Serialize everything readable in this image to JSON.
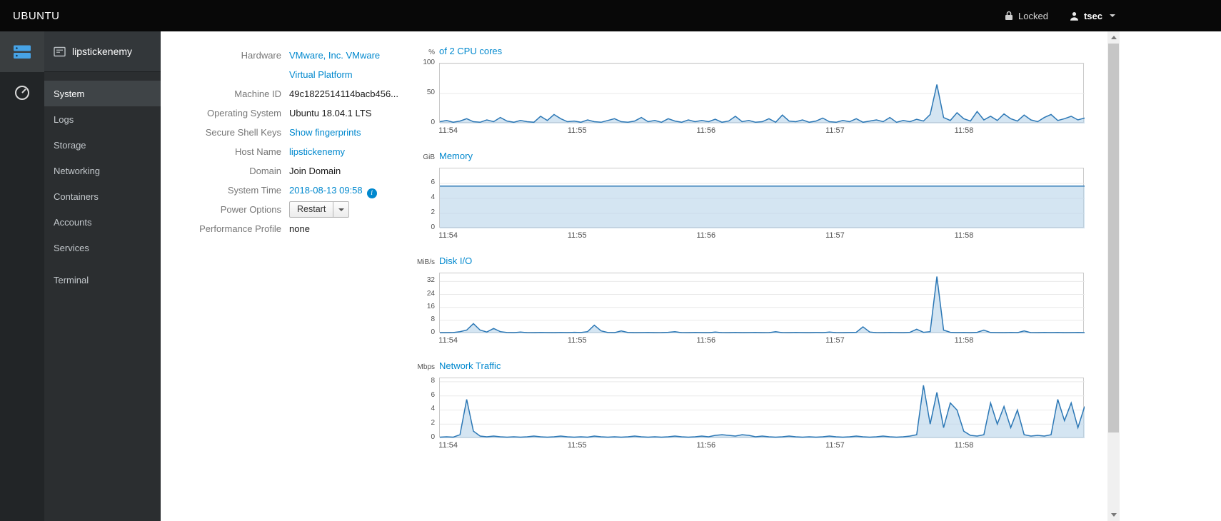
{
  "colors": {
    "link": "#0088ce",
    "chart_line": "#2b77b5",
    "chart_fill": "#b8d3ea",
    "masthead": "#080808"
  },
  "topbar": {
    "brand": "UBUNTU",
    "locked_label": "Locked",
    "user_name": "tsec"
  },
  "sidebar": {
    "hostname": "lipstickenemy",
    "items": [
      {
        "label": "System"
      },
      {
        "label": "Logs"
      },
      {
        "label": "Storage"
      },
      {
        "label": "Networking"
      },
      {
        "label": "Containers"
      },
      {
        "label": "Accounts"
      },
      {
        "label": "Services"
      },
      {
        "label": "Terminal"
      }
    ]
  },
  "info": {
    "hardware_label": "Hardware",
    "hardware_value_1": "VMware, Inc. VMware",
    "hardware_value_2": "Virtual Platform",
    "machine_id_label": "Machine ID",
    "machine_id_value": "49c1822514114bacb456...",
    "os_label": "Operating System",
    "os_value": "Ubuntu 18.04.1 LTS",
    "ssh_label": "Secure Shell Keys",
    "ssh_value": "Show fingerprints",
    "hostname_label": "Host Name",
    "hostname_value": "lipstickenemy",
    "domain_label": "Domain",
    "domain_value": "Join Domain",
    "time_label": "System Time",
    "time_value": "2018-08-13 09:58",
    "time_info_glyph": "i",
    "power_label": "Power Options",
    "power_button": "Restart",
    "profile_label": "Performance Profile",
    "profile_value": "none"
  },
  "chart_data": [
    {
      "type": "area",
      "unit": "%",
      "title": "of 2 CPU cores",
      "ylim": [
        0,
        100
      ],
      "yticks": [
        0,
        50,
        100
      ],
      "x_min": -0.07,
      "x_max": 4.93,
      "x_ticks": [
        0,
        1,
        2,
        3,
        4
      ],
      "x_labels": [
        "11:54",
        "11:55",
        "11:56",
        "11:57",
        "11:58"
      ],
      "values": [
        3,
        5,
        2,
        4,
        8,
        3,
        2,
        6,
        3,
        10,
        4,
        2,
        5,
        3,
        2,
        12,
        5,
        15,
        8,
        3,
        4,
        2,
        6,
        3,
        2,
        5,
        8,
        3,
        2,
        4,
        10,
        3,
        5,
        2,
        8,
        4,
        2,
        6,
        3,
        5,
        3,
        7,
        2,
        4,
        12,
        3,
        5,
        2,
        3,
        8,
        2,
        14,
        4,
        3,
        6,
        2,
        4,
        9,
        3,
        2,
        5,
        3,
        8,
        2,
        4,
        6,
        3,
        10,
        2,
        5,
        3,
        7,
        4,
        15,
        65,
        10,
        5,
        18,
        8,
        4,
        20,
        6,
        12,
        5,
        16,
        8,
        4,
        14,
        6,
        3,
        10,
        15,
        5,
        8,
        12,
        6,
        9
      ]
    },
    {
      "type": "area",
      "unit": "GiB",
      "title": "Memory",
      "ylim": [
        0,
        8
      ],
      "yticks": [
        0,
        2,
        4,
        6
      ],
      "x_min": -0.07,
      "x_max": 4.93,
      "x_ticks": [
        0,
        1,
        2,
        3,
        4
      ],
      "x_labels": [
        "11:54",
        "11:55",
        "11:56",
        "11:57",
        "11:58"
      ],
      "values": [
        5.65,
        5.65
      ]
    },
    {
      "type": "area",
      "unit": "MiB/s",
      "title": "Disk I/O",
      "ylim": [
        0,
        37
      ],
      "yticks": [
        0,
        8,
        16,
        24,
        32
      ],
      "x_min": -0.07,
      "x_max": 4.93,
      "x_ticks": [
        0,
        1,
        2,
        3,
        4
      ],
      "x_labels": [
        "11:54",
        "11:55",
        "11:56",
        "11:57",
        "11:58"
      ],
      "values": [
        0.3,
        0.4,
        0.5,
        1,
        2,
        6,
        2,
        0.8,
        3,
        1,
        0.5,
        0.4,
        0.8,
        0.4,
        0.3,
        0.5,
        0.4,
        0.3,
        0.5,
        0.4,
        0.6,
        0.5,
        1,
        5,
        1.5,
        0.5,
        0.4,
        1.5,
        0.5,
        0.3,
        0.4,
        0.5,
        0.3,
        0.4,
        0.6,
        1,
        0.4,
        0.3,
        0.5,
        0.4,
        0.3,
        0.8,
        0.4,
        0.3,
        0.5,
        0.3,
        0.4,
        0.5,
        0.3,
        0.4,
        1,
        0.4,
        0.3,
        0.5,
        0.4,
        0.3,
        0.5,
        0.4,
        0.8,
        0.4,
        0.3,
        0.5,
        0.6,
        4,
        0.8,
        0.4,
        0.3,
        0.5,
        0.4,
        0.3,
        0.6,
        2.5,
        0.6,
        1,
        35,
        2,
        0.6,
        0.4,
        0.5,
        0.3,
        0.6,
        2,
        0.5,
        0.4,
        0.3,
        0.5,
        0.4,
        1.5,
        0.4,
        0.3,
        0.5,
        0.4,
        0.5,
        0.3,
        0.4,
        0.5,
        0.4
      ]
    },
    {
      "type": "area",
      "unit": "Mbps",
      "title": "Network Traffic",
      "ylim": [
        0,
        8.5
      ],
      "yticks": [
        0,
        2,
        4,
        6,
        8
      ],
      "x_min": -0.07,
      "x_max": 4.93,
      "x_ticks": [
        0,
        1,
        2,
        3,
        4
      ],
      "x_labels": [
        "11:54",
        "11:55",
        "11:56",
        "11:57",
        "11:58"
      ],
      "values": [
        0.15,
        0.2,
        0.15,
        0.5,
        5.5,
        1,
        0.3,
        0.2,
        0.3,
        0.2,
        0.15,
        0.2,
        0.15,
        0.2,
        0.3,
        0.2,
        0.15,
        0.2,
        0.3,
        0.2,
        0.15,
        0.2,
        0.15,
        0.3,
        0.2,
        0.15,
        0.2,
        0.15,
        0.2,
        0.3,
        0.2,
        0.15,
        0.2,
        0.15,
        0.2,
        0.3,
        0.2,
        0.15,
        0.2,
        0.3,
        0.2,
        0.4,
        0.5,
        0.4,
        0.3,
        0.5,
        0.4,
        0.2,
        0.3,
        0.2,
        0.15,
        0.2,
        0.3,
        0.2,
        0.15,
        0.2,
        0.15,
        0.2,
        0.3,
        0.2,
        0.15,
        0.2,
        0.3,
        0.2,
        0.15,
        0.2,
        0.3,
        0.2,
        0.15,
        0.2,
        0.3,
        0.5,
        7.5,
        2,
        6.5,
        1.5,
        5,
        4,
        1,
        0.4,
        0.3,
        0.5,
        5,
        2,
        4.5,
        1.5,
        4,
        0.5,
        0.3,
        0.4,
        0.3,
        0.5,
        5.5,
        2.5,
        5,
        1.5,
        4.5
      ]
    }
  ]
}
